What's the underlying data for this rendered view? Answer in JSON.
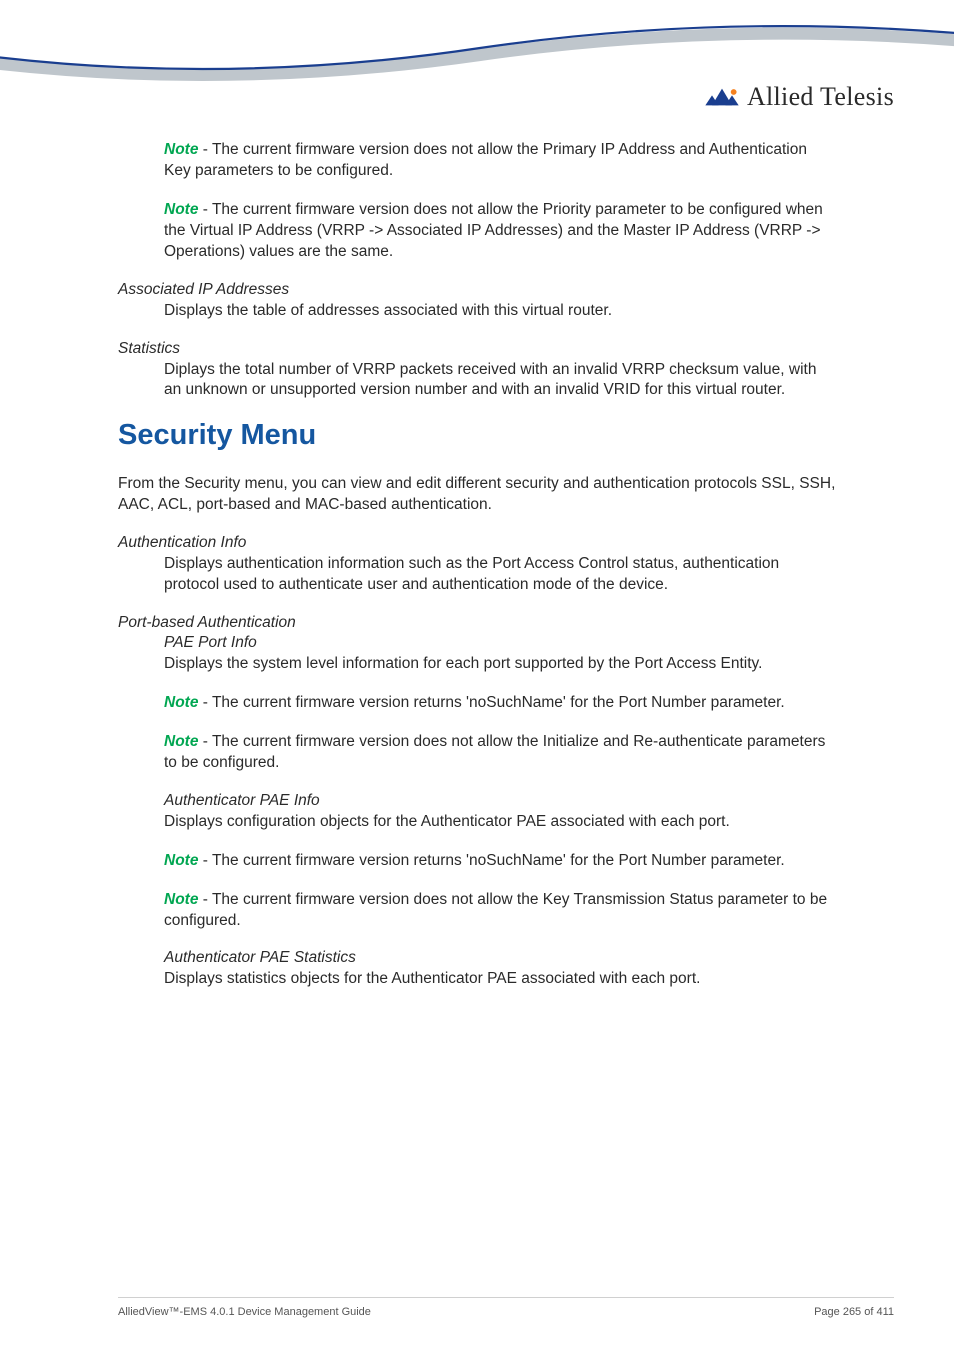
{
  "logo_text": "Allied Telesis",
  "note1": {
    "label": "Note",
    "text": " - The current firmware version does not allow the Primary IP Address and Authentication Key parameters to be configured."
  },
  "note2": {
    "label": "Note",
    "text": " - The current firmware version does not allow the Priority parameter to be configured when the Virtual IP Address (VRRP -> Associated IP Addresses) and the Master IP Address (VRRP -> Operations) values are the same."
  },
  "assoc_ip": {
    "heading": "Associated IP Addresses",
    "body": "Displays the table of addresses associated with this virtual router."
  },
  "statistics": {
    "heading": "Statistics",
    "body": "Diplays the total number of VRRP packets received with an invalid VRRP checksum value, with an unknown or unsupported version number and with an invalid VRID for this virtual router."
  },
  "security_heading": "Security Menu",
  "security_intro": "From the Security menu, you can view and edit different security and authentication protocols SSL, SSH, AAC, ACL, port-based and MAC-based authentication.",
  "auth_info": {
    "heading": "Authentication Info",
    "body": "Displays authentication information such as the Port Access Control status, authentication protocol used to authenticate user and authentication mode of the device."
  },
  "port_based": {
    "heading": "Port-based Authentication",
    "pae_port": {
      "heading": "PAE Port Info",
      "body": "Displays the system level information for each port supported by the Port Access Entity."
    },
    "note3": {
      "label": "Note",
      "text": " - The current firmware version returns 'noSuchName' for the Port Number parameter."
    },
    "note4": {
      "label": "Note",
      "text": " - The current firmware version does not allow the Initialize and Re-authenticate parameters to be configured."
    },
    "auth_pae_info": {
      "heading": "Authenticator PAE Info",
      "body": "Displays configuration objects for the Authenticator PAE associated with each port."
    },
    "note5": {
      "label": "Note",
      "text": " - The current firmware version returns 'noSuchName' for the Port Number parameter."
    },
    "note6": {
      "label": "Note",
      "text": " - The current firmware version does not allow the Key Transmission Status parameter to be configured."
    },
    "auth_pae_stats": {
      "heading": "Authenticator PAE Statistics",
      "body": "Displays statistics objects for the Authenticator PAE associated with each port."
    }
  },
  "footer": {
    "left": "AlliedView™-EMS 4.0.1 Device Management Guide",
    "right": "Page 265 of 411"
  }
}
